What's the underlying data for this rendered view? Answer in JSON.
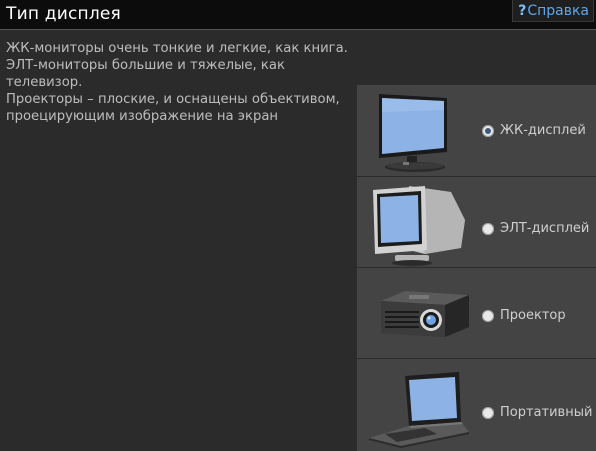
{
  "window": {
    "title": "Тип дисплея",
    "help_label": "Справка"
  },
  "description": {
    "line1": "ЖК-мониторы очень тонкие и легкие, как книга.",
    "line2": "ЭЛТ-мониторы большие и тяжелые, как телевизор.",
    "line3": "Проекторы – плоские, и оснащены объективом, проецирующим изображение на экран"
  },
  "options": [
    {
      "label": "ЖК-дисплей",
      "icon": "lcd-monitor-icon",
      "selected": true
    },
    {
      "label": "ЭЛТ-дисплей",
      "icon": "crt-monitor-icon",
      "selected": false
    },
    {
      "label": "Проектор",
      "icon": "projector-icon",
      "selected": false
    },
    {
      "label": "Портативный",
      "icon": "laptop-icon",
      "selected": false
    }
  ],
  "colors": {
    "background": "#2b2b2b",
    "panel": "#444444",
    "titlebar": "#0c0c0c",
    "link": "#5fa8e8",
    "screen": "#8db3e6"
  }
}
